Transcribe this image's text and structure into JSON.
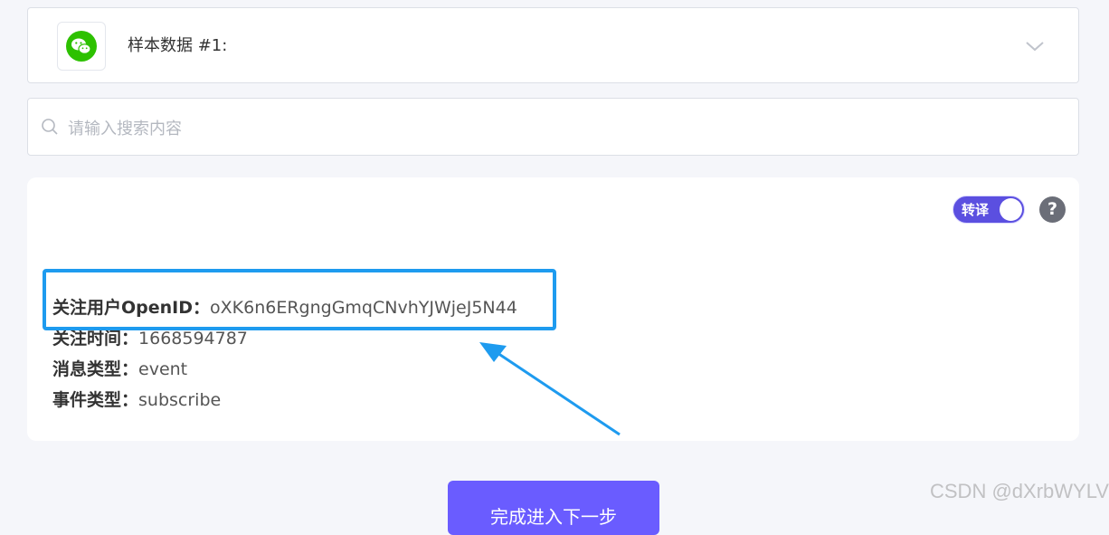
{
  "sample": {
    "title": "样本数据 #1:",
    "logo_icon": "wechat-icon",
    "dropdown_icon": "chevron-down-icon"
  },
  "search": {
    "placeholder": "请输入搜索内容",
    "value": "",
    "icon": "search-icon"
  },
  "panel": {
    "toggle_label": "转译",
    "toggle_on": true,
    "help_symbol": "?",
    "fields": [
      {
        "label": "关注用户OpenID：",
        "value": "oXK6n6ERgngGmqCNvhYJWjeJ5N44"
      },
      {
        "label": "关注时间：",
        "value": "1668594787"
      },
      {
        "label": "消息类型：",
        "value": "event"
      },
      {
        "label": "事件类型：",
        "value": "subscribe"
      }
    ]
  },
  "footer": {
    "next_button_label": "完成进入下一步"
  },
  "watermark": "CSDN @dXrbWYLV",
  "colors": {
    "accent": "#6a5cff",
    "toggle": "#5b4fe0",
    "wechat": "#2dc100",
    "highlight": "#1e9bef"
  }
}
